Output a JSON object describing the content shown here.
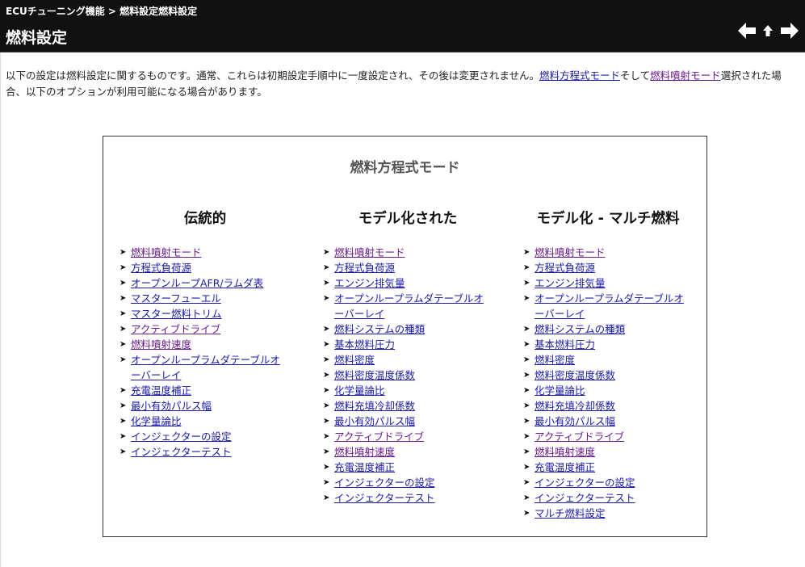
{
  "header": {
    "breadcrumb_parent": "ECUチューニング機能",
    "breadcrumb_sep": " > ",
    "breadcrumb_current": "燃料設定燃料設定",
    "title": "燃料設定",
    "nav": {
      "back_icon": "arrow-left-icon",
      "up_icon": "arrow-up-icon",
      "forward_icon": "arrow-right-icon"
    }
  },
  "intro": {
    "text1": "以下の設定は燃料設定に関するものです。通常、これらは初期設定手順中に一度設定され、その後は変更されません。",
    "link1": "燃料方程式モード",
    "text2": "そして",
    "link2": "燃料噴射モード",
    "text3": "選択された場合、以下のオプションが利用可能になる場合があります。"
  },
  "box": {
    "title": "燃料方程式モード",
    "columns": [
      {
        "heading": "伝統的",
        "items": [
          {
            "label": "燃料噴射モード",
            "visited": true
          },
          {
            "label": "方程式負荷源",
            "visited": false
          },
          {
            "label": "オープンループAFR/ラムダ表",
            "visited": false
          },
          {
            "label": "マスターフューエル",
            "visited": false
          },
          {
            "label": "マスター燃料トリム",
            "visited": false
          },
          {
            "label": "アクティブドライブ",
            "visited": true
          },
          {
            "label": "燃料噴射速度",
            "visited": true
          },
          {
            "label": "オープンループラムダテーブルオーバーレイ",
            "visited": false
          },
          {
            "label": "充電温度補正",
            "visited": false
          },
          {
            "label": "最小有効パルス幅",
            "visited": false
          },
          {
            "label": "化学量論比",
            "visited": false
          },
          {
            "label": "インジェクターの設定",
            "visited": false
          },
          {
            "label": "インジェクターテスト",
            "visited": false
          }
        ]
      },
      {
        "heading": "モデル化された",
        "items": [
          {
            "label": "燃料噴射モード",
            "visited": true
          },
          {
            "label": "方程式負荷源",
            "visited": false
          },
          {
            "label": "エンジン排気量",
            "visited": false
          },
          {
            "label": "オープンループラムダテーブルオーバーレイ",
            "visited": false
          },
          {
            "label": "燃料システムの種類",
            "visited": false
          },
          {
            "label": "基本燃料圧力",
            "visited": false
          },
          {
            "label": "燃料密度",
            "visited": false
          },
          {
            "label": "燃料密度温度係数",
            "visited": false
          },
          {
            "label": "化学量論比",
            "visited": false
          },
          {
            "label": "燃料充填冷却係数",
            "visited": false
          },
          {
            "label": "最小有効パルス幅",
            "visited": false
          },
          {
            "label": "アクティブドライブ",
            "visited": true
          },
          {
            "label": "燃料噴射速度",
            "visited": true
          },
          {
            "label": "充電温度補正",
            "visited": false
          },
          {
            "label": "インジェクターの設定",
            "visited": false
          },
          {
            "label": "インジェクターテスト",
            "visited": false
          }
        ]
      },
      {
        "heading": "モデル化 - マルチ燃料",
        "items": [
          {
            "label": "燃料噴射モード",
            "visited": true
          },
          {
            "label": "方程式負荷源",
            "visited": false
          },
          {
            "label": "エンジン排気量",
            "visited": false
          },
          {
            "label": "オープンループラムダテーブルオーバーレイ",
            "visited": false
          },
          {
            "label": "燃料システムの種類",
            "visited": false
          },
          {
            "label": "基本燃料圧力",
            "visited": false
          },
          {
            "label": "燃料密度",
            "visited": false
          },
          {
            "label": "燃料密度温度係数",
            "visited": false
          },
          {
            "label": "化学量論比",
            "visited": false
          },
          {
            "label": "燃料充填冷却係数",
            "visited": false
          },
          {
            "label": "最小有効パルス幅",
            "visited": false
          },
          {
            "label": "アクティブドライブ",
            "visited": true
          },
          {
            "label": "燃料噴射速度",
            "visited": true
          },
          {
            "label": "充電温度補正",
            "visited": false
          },
          {
            "label": "インジェクターの設定",
            "visited": false
          },
          {
            "label": "インジェクターテスト",
            "visited": false
          },
          {
            "label": "マルチ燃料設定",
            "visited": false
          }
        ]
      }
    ]
  },
  "colors": {
    "header_bg": "#111111",
    "link": "#1a1aa6",
    "link_visited": "#6a1b8a"
  }
}
